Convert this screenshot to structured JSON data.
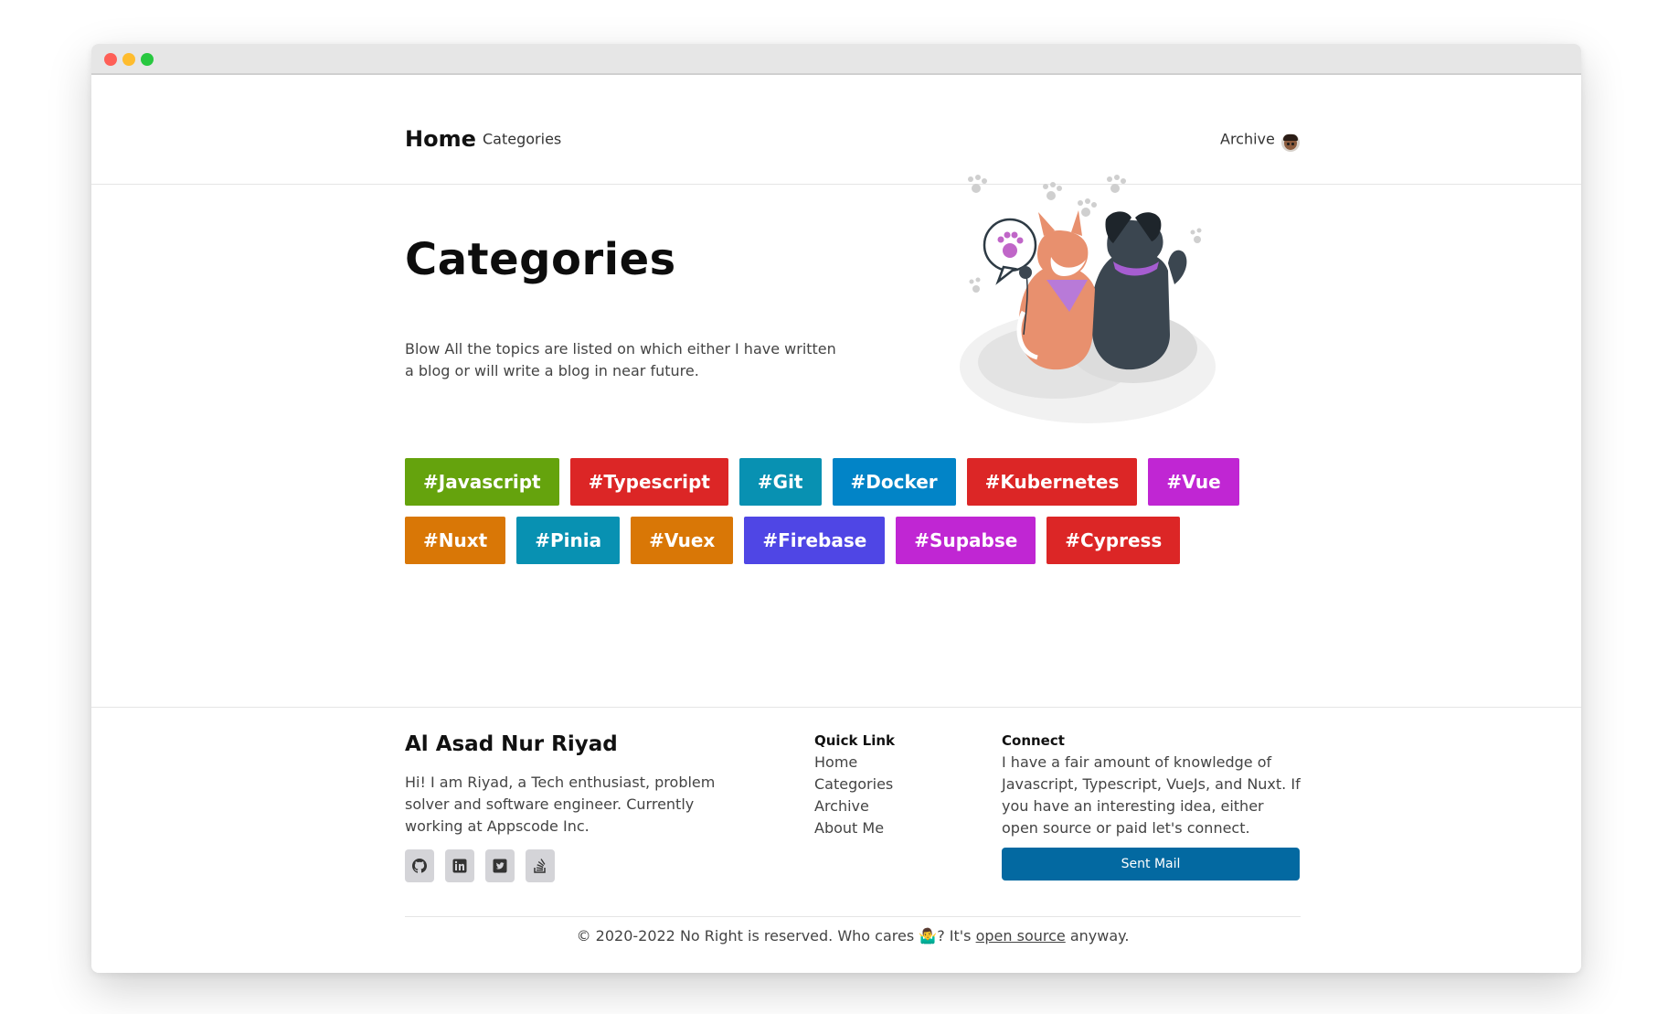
{
  "nav": {
    "brand": "Home",
    "categories_link": "Categories",
    "archive_link": "Archive"
  },
  "hero": {
    "title": "Categories",
    "description": "Blow All the topics are listed on which either I have written a blog or will write a blog in near future."
  },
  "tags": [
    {
      "label": "#Javascript",
      "color": "#65a30d"
    },
    {
      "label": "#Typescript",
      "color": "#dc2626"
    },
    {
      "label": "#Git",
      "color": "#0891b2"
    },
    {
      "label": "#Docker",
      "color": "#0284c7"
    },
    {
      "label": "#Kubernetes",
      "color": "#dc2626"
    },
    {
      "label": "#Vue",
      "color": "#c026d3"
    },
    {
      "label": "#Nuxt",
      "color": "#d97706"
    },
    {
      "label": "#Pinia",
      "color": "#0891b2"
    },
    {
      "label": "#Vuex",
      "color": "#d97706"
    },
    {
      "label": "#Firebase",
      "color": "#4f46e5"
    },
    {
      "label": "#Supabse",
      "color": "#c026d3"
    },
    {
      "label": "#Cypress",
      "color": "#dc2626"
    }
  ],
  "footer": {
    "name": "Al Asad Nur Riyad",
    "bio": "Hi! I am Riyad, a Tech enthusiast, problem solver and software engineer. Currently working at Appscode Inc.",
    "socials": [
      "github-icon",
      "linkedin-icon",
      "twitter-icon",
      "stackoverflow-icon"
    ],
    "quick_link": {
      "heading": "Quick Link",
      "links": [
        "Home",
        "Categories",
        "Archive",
        "About Me"
      ]
    },
    "connect": {
      "heading": "Connect",
      "text": "I have a fair amount of knowledge of Javascript, Typescript, VueJs, and Nuxt. If you have an interesting idea, either open source or paid let's connect.",
      "button": "Sent Mail"
    },
    "copyright_before": "© 2020-2022 No Right is reserved. Who cares 🤷‍♂️? It's ",
    "copyright_link": "open source",
    "copyright_after": " anyway."
  },
  "colors": {
    "accent_button": "#0369a1"
  }
}
